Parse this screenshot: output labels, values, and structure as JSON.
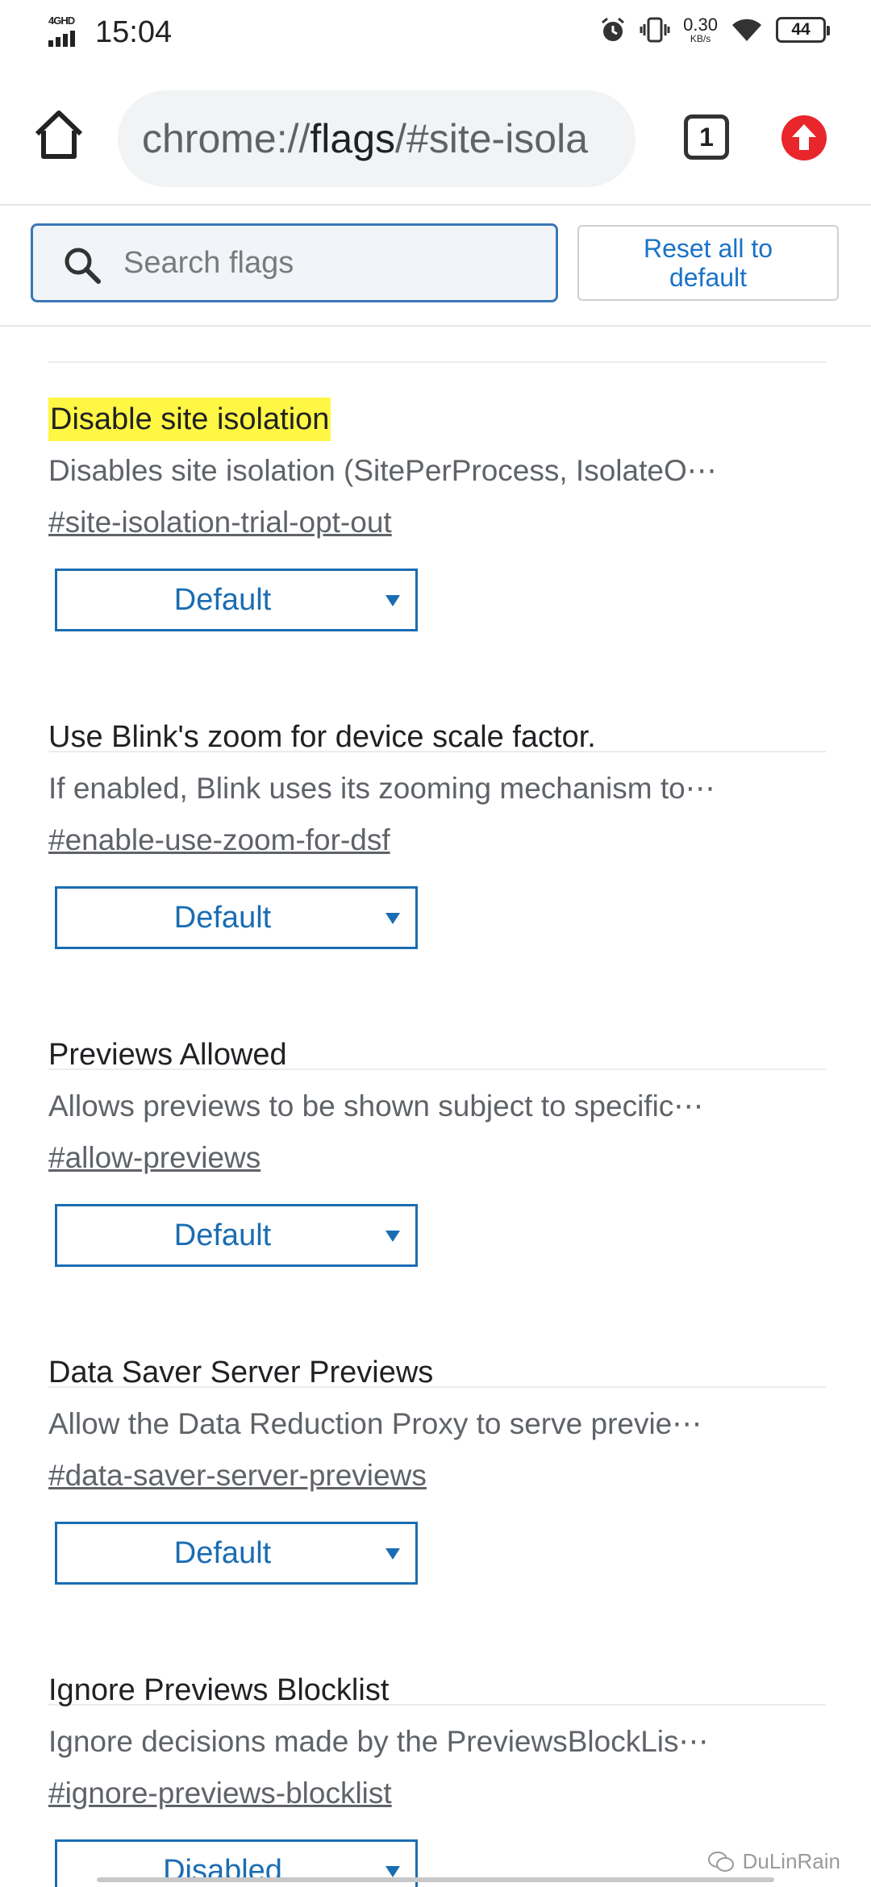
{
  "status_bar": {
    "network": "4GHD",
    "time": "15:04",
    "speed_value": "0.30",
    "speed_unit": "KB/s",
    "battery": "44"
  },
  "toolbar": {
    "url_prefix": "chrome://",
    "url_domain": "flags",
    "url_rest": "/#site-isola",
    "tab_count": "1"
  },
  "search": {
    "placeholder": "Search flags",
    "value": ""
  },
  "reset_button": {
    "line1": "Reset all to",
    "line2": "default"
  },
  "flags": [
    {
      "title": "Disable site isolation",
      "description": "Disables site isolation (SitePerProcess, IsolateO⋯",
      "link": "#site-isolation-trial-opt-out",
      "value": "Default",
      "highlighted": true
    },
    {
      "title": "Use Blink's zoom for device scale factor.",
      "description": "If enabled, Blink uses its zooming mechanism to⋯",
      "link": "#enable-use-zoom-for-dsf",
      "value": "Default"
    },
    {
      "title": "Previews Allowed",
      "description": "Allows previews to be shown subject to specific⋯",
      "link": "#allow-previews",
      "value": "Default"
    },
    {
      "title": "Data Saver Server Previews",
      "description": "Allow the Data Reduction Proxy to serve previe⋯",
      "link": "#data-saver-server-previews",
      "value": "Default"
    },
    {
      "title": "Ignore Previews Blocklist",
      "description": "Ignore decisions made by the PreviewsBlockLis⋯",
      "link": "#ignore-previews-blocklist",
      "value": "Disabled"
    }
  ],
  "watermark": "DuLinRain",
  "colors": {
    "accent": "#1a6db3",
    "highlight": "#fff744",
    "update_badge": "#e8262b"
  }
}
